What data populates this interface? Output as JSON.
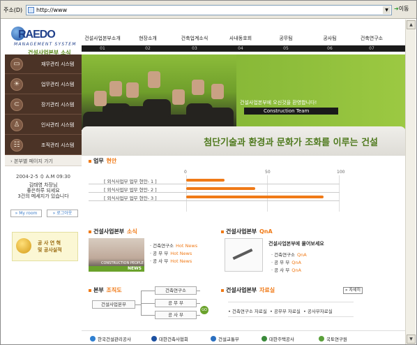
{
  "address_bar": {
    "label": "주소(D)",
    "url": "http://www",
    "go_label": "이동"
  },
  "logo": {
    "brand": "RAEDO",
    "system": "MANAGEMENT SYSTEM",
    "subtitle": "건설사업본부 소식"
  },
  "nav": [
    {
      "label": "건설사업본부소개",
      "num": "01"
    },
    {
      "label": "현장소개",
      "num": "02"
    },
    {
      "label": "건축업계소식",
      "num": "03"
    },
    {
      "label": "사내동호회",
      "num": "04"
    },
    {
      "label": "공무팀",
      "num": "05"
    },
    {
      "label": "공사팀",
      "num": "06"
    },
    {
      "label": "건축연구소",
      "num": "07"
    }
  ],
  "side_menu": [
    {
      "label": "재무관리 시스템",
      "icon": "folder-icon"
    },
    {
      "label": "업무관리 시스템",
      "icon": "lightbulb-icon"
    },
    {
      "label": "장기관리 시스템",
      "icon": "plug-icon"
    },
    {
      "label": "인사관리 시스템",
      "icon": "person-icon"
    },
    {
      "label": "조직관리 시스템",
      "icon": "org-icon"
    }
  ],
  "hero": {
    "welcome": "건설사업본부에 오신것을 환영합니다!",
    "team": "Construction Team"
  },
  "banner_text": "첨단기술과 환경과 문화가 조화를 이루는 건설",
  "sidebar": {
    "link": "본부별 페이지 가기",
    "date": "2004-2-5 수 A.M 09:30",
    "name": "김태영 차장님",
    "greeting": "좋은하루 되세요",
    "message": "3건의 메세지가 있습니다",
    "myroom": "My room",
    "logout": "로그아웃",
    "banner_line1": "공 사 연 혁",
    "banner_line2": "및 공사실적"
  },
  "current": {
    "title": "업무",
    "title_accent": "현안",
    "axis": [
      "0",
      "50",
      "100"
    ],
    "rows": [
      {
        "label": "[ 외식사업부 업무 현안- 1 ]",
        "value": 25
      },
      {
        "label": "[ 외식사업부 업무 현안- 2 ]",
        "value": 45
      },
      {
        "label": "[ 외식사업부 업무 현안- 3 ]",
        "value": 90
      }
    ]
  },
  "news": {
    "title": "건설사업본부",
    "title_accent": "소식",
    "pic_caption": "CONSTRUCTION PEOPLE",
    "pic_news": "NEWS",
    "items": [
      {
        "label": "건축연구소",
        "tag": "Hot News"
      },
      {
        "label": "공 무 부",
        "tag": "Hot News"
      },
      {
        "label": "공 사 부",
        "tag": "Hot News"
      }
    ]
  },
  "qna": {
    "title": "건설사업본부",
    "title_accent": "QnA",
    "ask": "건설사업본부에 물어보세요",
    "items": [
      {
        "label": "건축연구소",
        "tag": "QnA"
      },
      {
        "label": "공 무 부",
        "tag": "QnA"
      },
      {
        "label": "공 사 부",
        "tag": "QnA"
      }
    ]
  },
  "org": {
    "title": "본부",
    "title_accent": "조직도",
    "root": "건설사업본부",
    "children": [
      "건축연구소",
      "공 무 부",
      "공 사 부"
    ],
    "badge": "GO"
  },
  "data": {
    "title": "건설사업본부",
    "title_accent": "자료실",
    "more": "자세히",
    "items": [
      "건축연구소 자료실",
      "공무부 자료실",
      "공사부자료실"
    ]
  },
  "footer": [
    {
      "label": "한국건설관리공사",
      "color": "#2f7fd0"
    },
    {
      "label": "대한건축사협회",
      "color": "#1b4fa0"
    },
    {
      "label": "건설교통부",
      "color": "#2a6fc0"
    },
    {
      "label": "대한주택공사",
      "color": "#3a8a3a"
    },
    {
      "label": "국토연구원",
      "color": "#5aa03a"
    }
  ]
}
